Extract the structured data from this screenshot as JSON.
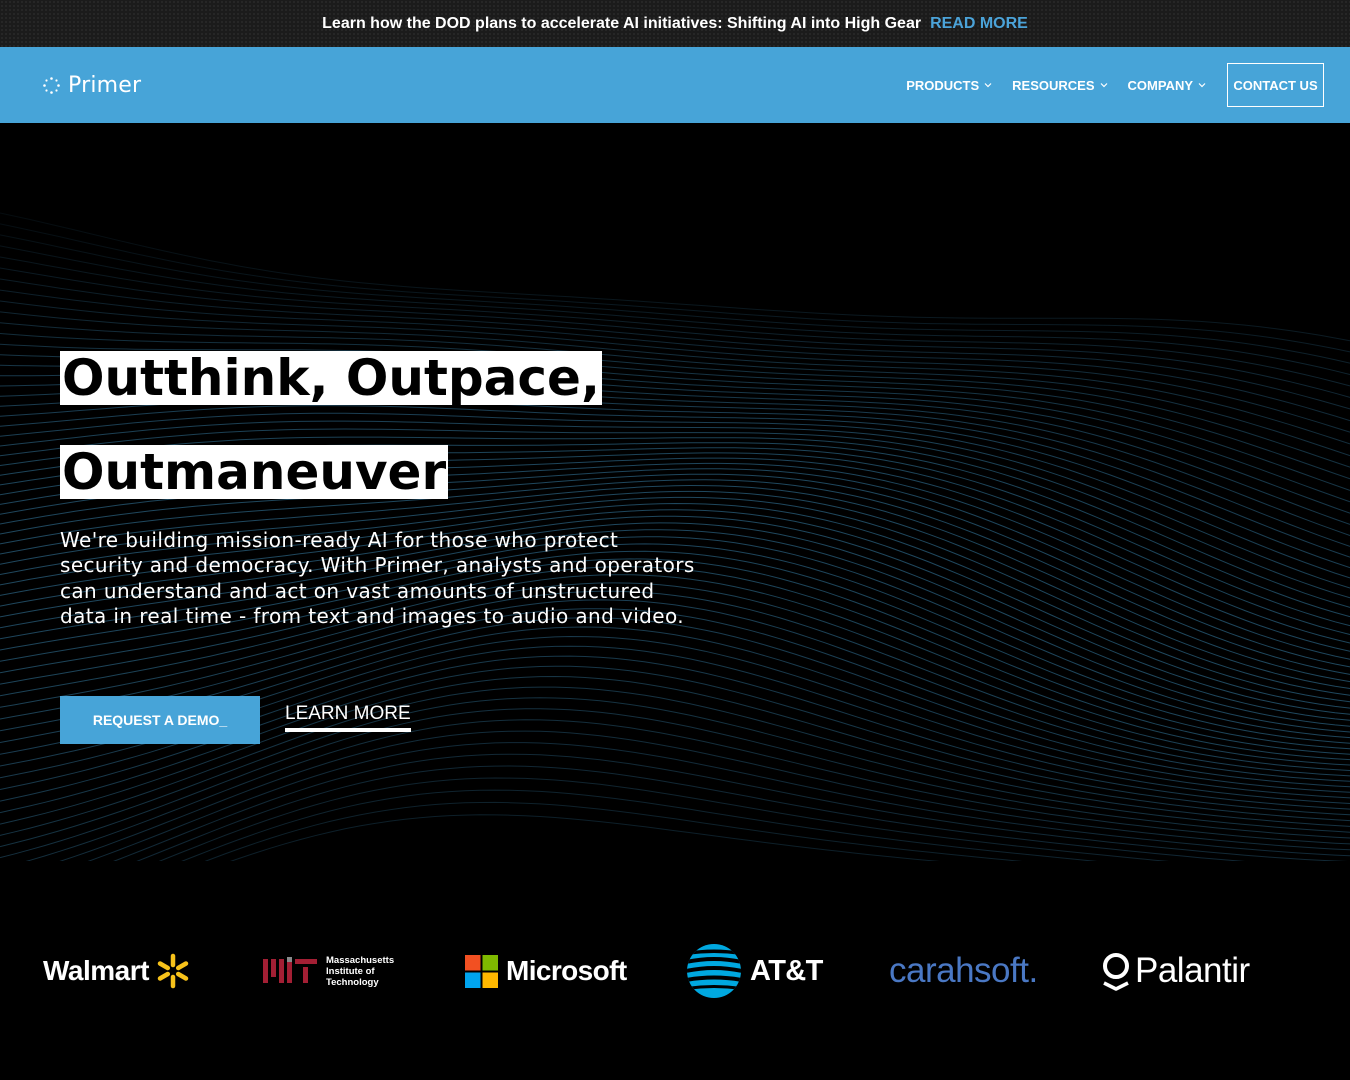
{
  "announcement": {
    "message": "Learn how the DOD plans to accelerate AI initiatives: Shifting AI into High Gear",
    "link_label": "READ MORE",
    "link_color": "#4ba3d9"
  },
  "nav": {
    "brand": "Primer",
    "background": "#47a4d8",
    "items": [
      {
        "label": "PRODUCTS",
        "icon": "chevron-down-icon"
      },
      {
        "label": "RESOURCES",
        "icon": "chevron-down-icon"
      },
      {
        "label": "COMPANY",
        "icon": "chevron-down-icon"
      }
    ],
    "contact_label": "CONTACT US"
  },
  "hero": {
    "headline_line1": "Outthink, Outpace,",
    "headline_line2": "Outmaneuver",
    "lede": "We're building mission-ready AI for those who protect security and democracy. With Primer, analysts and operators can understand and act on vast amounts of unstructured data in real time - from text and images to audio and video.",
    "primary_cta": "REQUEST A DEMO_",
    "secondary_cta": "LEARN MORE",
    "wave_color": "#47a4d8"
  },
  "partners": {
    "walmart": "Walmart",
    "mit_lines": [
      "Massachusetts",
      "Institute of",
      "Technology"
    ],
    "microsoft": "Microsoft",
    "att": "AT&T",
    "carahsoft": "carahsoft.",
    "palantir": "Palantir"
  }
}
